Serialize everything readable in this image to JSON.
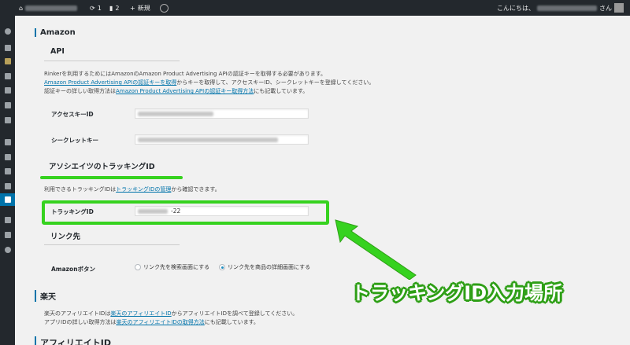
{
  "adminbar": {
    "updates_count": "1",
    "comments_count": "2",
    "new_label": "新規",
    "greeting_prefix": "こんにちは、",
    "greeting_suffix": "さん"
  },
  "amazon": {
    "title": "Amazon",
    "api_heading": "API",
    "desc_line1": "Rinkerを利用するためにはAmazonのAmazon Product Advertising APIの認証キーを取得する必要があります。",
    "desc_line2_link": "Amazon Product Advertising APIの認証キーを取得",
    "desc_line2_rest": "からキーを取得して、アクセスキーID、シークレットキーを登録してください。",
    "desc_line3_pre": "認証キーの詳しい取得方法は",
    "desc_line3_link": "Amazon Product Advertising APIの認証キー取得方法",
    "desc_line3_rest": "にも記載しています。",
    "access_key_label": "アクセスキーID",
    "secret_key_label": "シークレットキー",
    "tracking_heading": "アソシエイツのトラッキングID",
    "tracking_desc_pre": "利用できるトラッキングIDは",
    "tracking_desc_link": "トラッキングIDの管理",
    "tracking_desc_rest": "から確認できます。",
    "tracking_label": "トラッキングID",
    "tracking_value_suffix": "-22",
    "link_heading": "リンク先",
    "button_label": "Amazonボタン",
    "radio_option_1": "リンク先を検索画面にする",
    "radio_option_2": "リンク先を商品の詳細画面にする"
  },
  "rakuten": {
    "title": "楽天",
    "desc_line1_pre": "楽天のアフィリエイトIDは",
    "desc_line1_link": "楽天のアフィリエイトID",
    "desc_line1_rest": "からアフィリエイトIDを調べて登録してください。",
    "desc_line2_pre": "アプリIDの詳しい取得方法は",
    "desc_line2_link": "楽天のアフィリエイトIDの取得方法",
    "desc_line2_rest": "にも記載しています。",
    "affiliate_heading": "アフィリエイトID"
  },
  "annotation": {
    "callout_text": "トラッキングID入力場所",
    "highlight_color": "#36d21f"
  },
  "colors": {
    "link": "#0073aa",
    "adminbar": "#23282d"
  }
}
